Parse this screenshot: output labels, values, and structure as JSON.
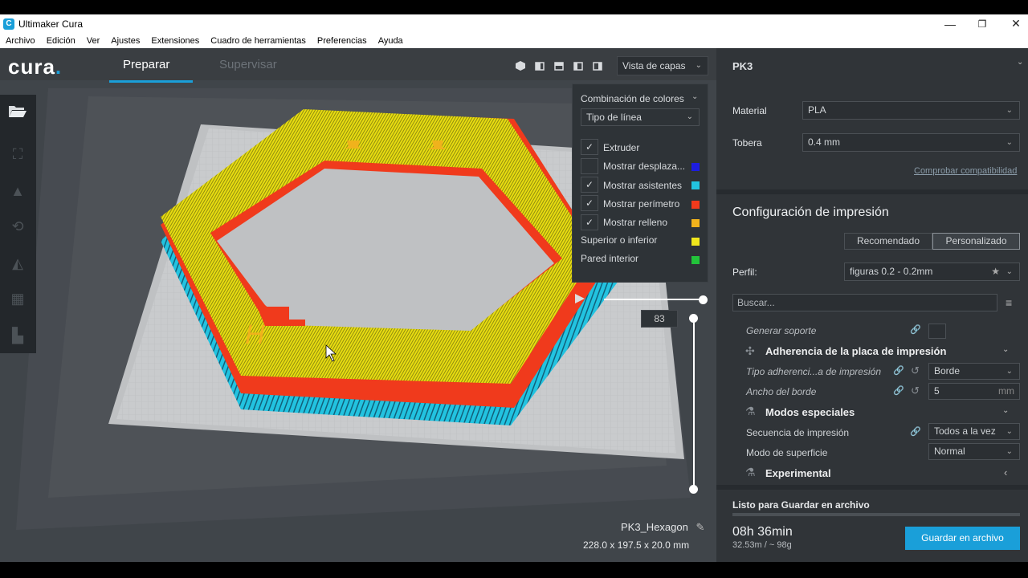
{
  "window": {
    "title": "Ultimaker Cura",
    "app_icon": "C",
    "controls": {
      "minimize": "—",
      "restore": "❐",
      "close": "✕"
    }
  },
  "menu": [
    "Archivo",
    "Edición",
    "Ver",
    "Ajustes",
    "Extensiones",
    "Cuadro de herramientas",
    "Preferencias",
    "Ayuda"
  ],
  "header": {
    "logo": "cura",
    "logo_dot": ".",
    "tabs": [
      {
        "label": "Preparar",
        "active": true
      },
      {
        "label": "Supervisar",
        "active": false
      }
    ],
    "view_mode": "Vista de capas",
    "chevron": "⌄"
  },
  "layer_panel": {
    "color_scheme_label": "Combinación de colores",
    "color_scheme_value": "Tipo de línea",
    "items": [
      {
        "label": "Extruder",
        "checked": true,
        "color": ""
      },
      {
        "label": "Mostrar desplaza...",
        "checked": false,
        "color": "#1d1de0"
      },
      {
        "label": "Mostrar asistentes",
        "checked": true,
        "color": "#22c3e0"
      },
      {
        "label": "Mostrar perímetro",
        "checked": true,
        "color": "#f03a1c"
      },
      {
        "label": "Mostrar relleno",
        "checked": true,
        "color": "#f0b21c"
      }
    ],
    "legend": [
      {
        "label": "Superior o inferior",
        "color": "#f0e61c"
      },
      {
        "label": "Pared interior",
        "color": "#22c33a"
      }
    ],
    "check_mark": "✓"
  },
  "layer_slider": {
    "current_layer": "83"
  },
  "object": {
    "name": "PK3_Hexagon",
    "dimensions": "228.0 x 197.5 x 20.0 mm",
    "edit_icon": "✎"
  },
  "right_panel": {
    "printer": "PK3",
    "material_label": "Material",
    "material_value": "PLA",
    "nozzle_label": "Tobera",
    "nozzle_value": "0.4 mm",
    "compat_link": "Comprobar compatibilidad",
    "print_setup_title": "Configuración de impresión",
    "mode_recommended": "Recomendado",
    "mode_custom": "Personalizado",
    "profile_label": "Perfil:",
    "profile_value": "figuras 0.2 - 0.2mm",
    "search_placeholder": "Buscar...",
    "settings": {
      "support_label": "Generar soporte",
      "adhesion_category": "Adherencia de la placa de impresión",
      "adhesion_type_label": "Tipo adherenci...a de impresión",
      "adhesion_type_value": "Borde",
      "brim_width_label": "Ancho del borde",
      "brim_width_value": "5",
      "brim_width_unit": "mm",
      "special_modes_category": "Modos especiales",
      "print_sequence_label": "Secuencia de impresión",
      "print_sequence_value": "Todos a la vez",
      "surface_mode_label": "Modo de superficie",
      "surface_mode_value": "Normal",
      "experimental_category": "Experimental"
    },
    "status": "Listo para Guardar en archivo",
    "print_time": "08h 36min",
    "material_usage": "32.53m / ~ 98g",
    "save_button": "Guardar en archivo"
  }
}
